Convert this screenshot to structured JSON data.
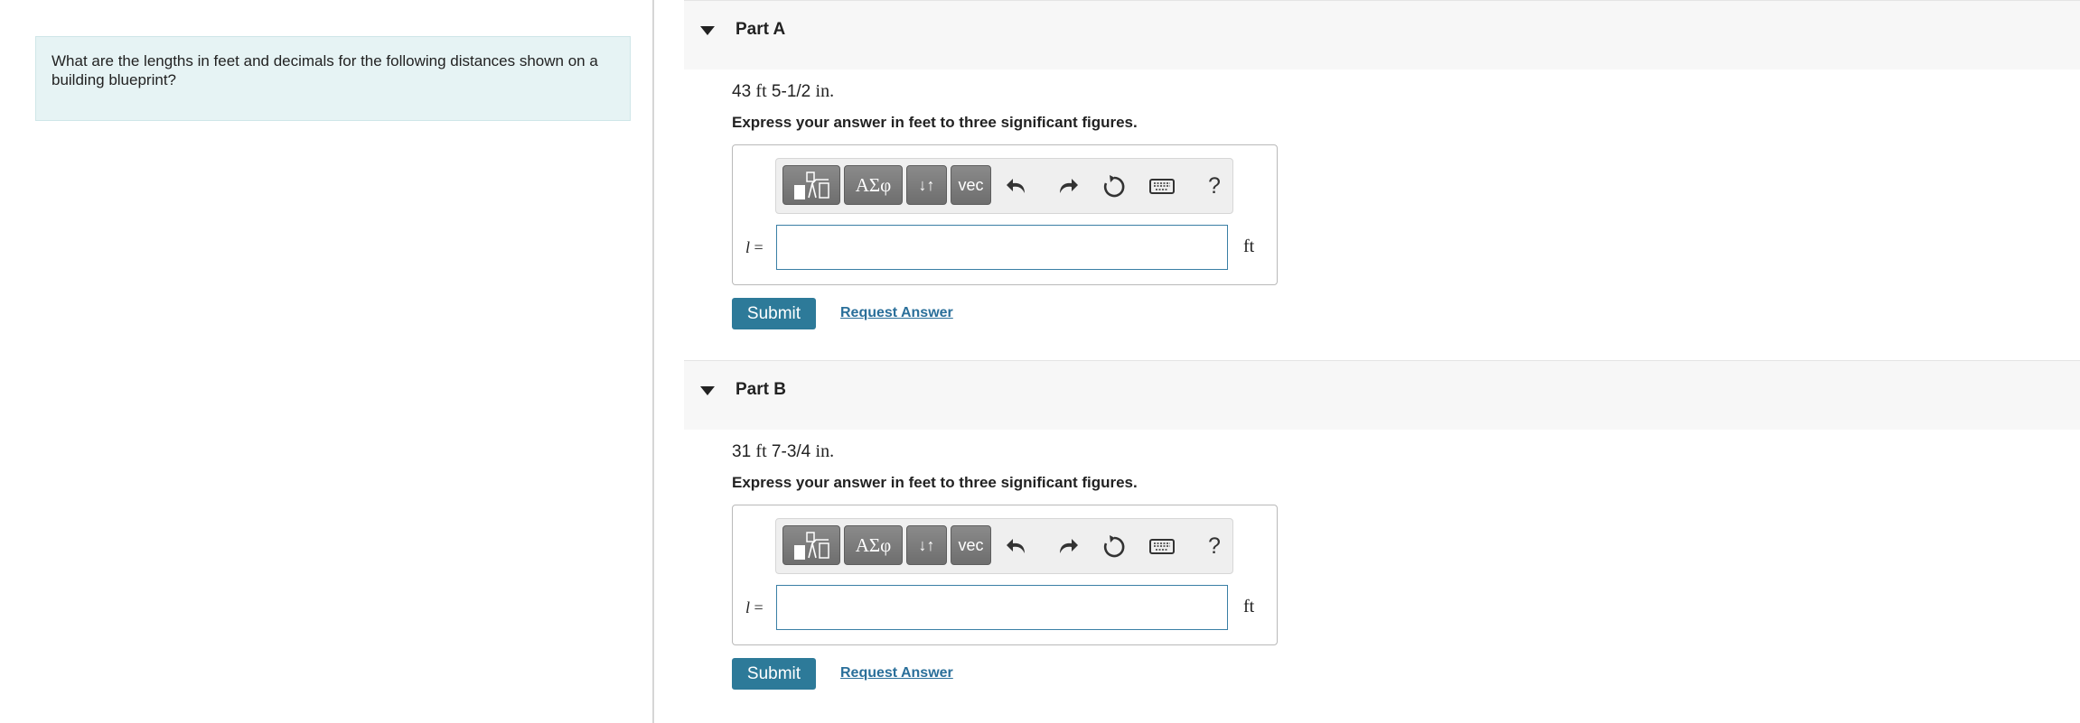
{
  "question": {
    "text": "What are the lengths in feet and decimals for the following distances shown on a building blueprint?"
  },
  "parts": [
    {
      "title": "Part A",
      "problem_ft_value": "43",
      "problem_ft_unit": "ft",
      "problem_in_value": "5-1/2",
      "problem_in_unit": "in.",
      "instruction": "Express your answer in feet to three significant figures.",
      "variable": "l",
      "equals": "=",
      "answer_value": "",
      "unit": "ft",
      "submit_label": "Submit",
      "request_label": "Request Answer"
    },
    {
      "title": "Part B",
      "problem_ft_value": "31",
      "problem_ft_unit": "ft",
      "problem_in_value": "7-3/4",
      "problem_in_unit": "in.",
      "instruction": "Express your answer in feet to three significant figures.",
      "variable": "l",
      "equals": "=",
      "answer_value": "",
      "unit": "ft",
      "submit_label": "Submit",
      "request_label": "Request Answer"
    }
  ],
  "toolbar": {
    "greek_label": "ΑΣφ",
    "arrows_label": "↓↑",
    "vec_label": "vec",
    "help_label": "?",
    "icons": [
      "templates-icon",
      "undo-icon",
      "redo-icon",
      "reset-icon",
      "keyboard-icon",
      "help-icon"
    ]
  },
  "colors": {
    "question_bg": "#e6f3f4",
    "submit_bg": "#2d7a99",
    "link": "#2a6f9a",
    "input_border": "#3a7fa5"
  }
}
